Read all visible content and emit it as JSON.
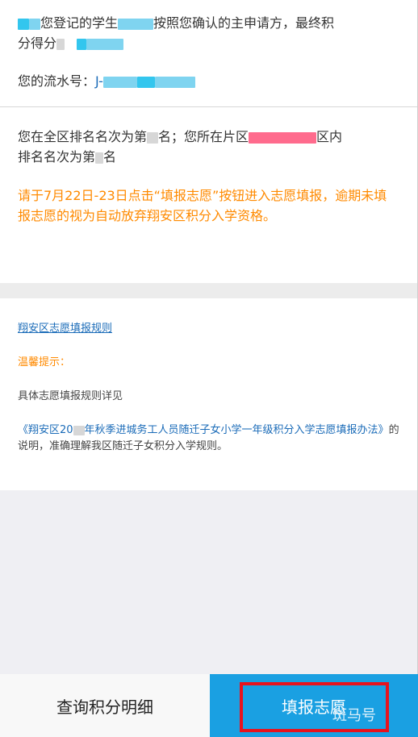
{
  "result": {
    "line1_before": "您登记的学生",
    "line1_after": "按照您确认的主申请方，最终积",
    "line2_before": "分得分",
    "serial_label": "您的流水号：",
    "serial_prefix": "J-"
  },
  "ranking": {
    "part1": "您在全区排名名次为第",
    "part2": "名；您所在片区",
    "part3": "区内",
    "part4": "排名名次为第",
    "part5": "名",
    "notice": "请于7月22日-23日点击“填报志愿”按钮进入志愿填报，逾期未填报志愿的视为自动放弃翔安区积分入学资格。"
  },
  "rules": {
    "link": "翔安区志愿填报规则",
    "tip_title": "温馨提示：",
    "tip_line": "具体志愿填报规则详见",
    "doc_title_a": "《翔安区20",
    "doc_title_b": "年秋季进城务工人员随迁子女小学一年级积分入学志愿填报办法》",
    "doc_tail": "的说明，准确理解我区随迁子女积分入学规则。"
  },
  "footer": {
    "query_label": "查询积分明细",
    "fill_label": "填报志愿",
    "watermark": "斑马号"
  },
  "colors": {
    "accent_blue": "#1aa0e2",
    "notice_orange": "#ff8a00",
    "link_blue": "#1a6bb8",
    "highlight_red": "#e8131d"
  }
}
